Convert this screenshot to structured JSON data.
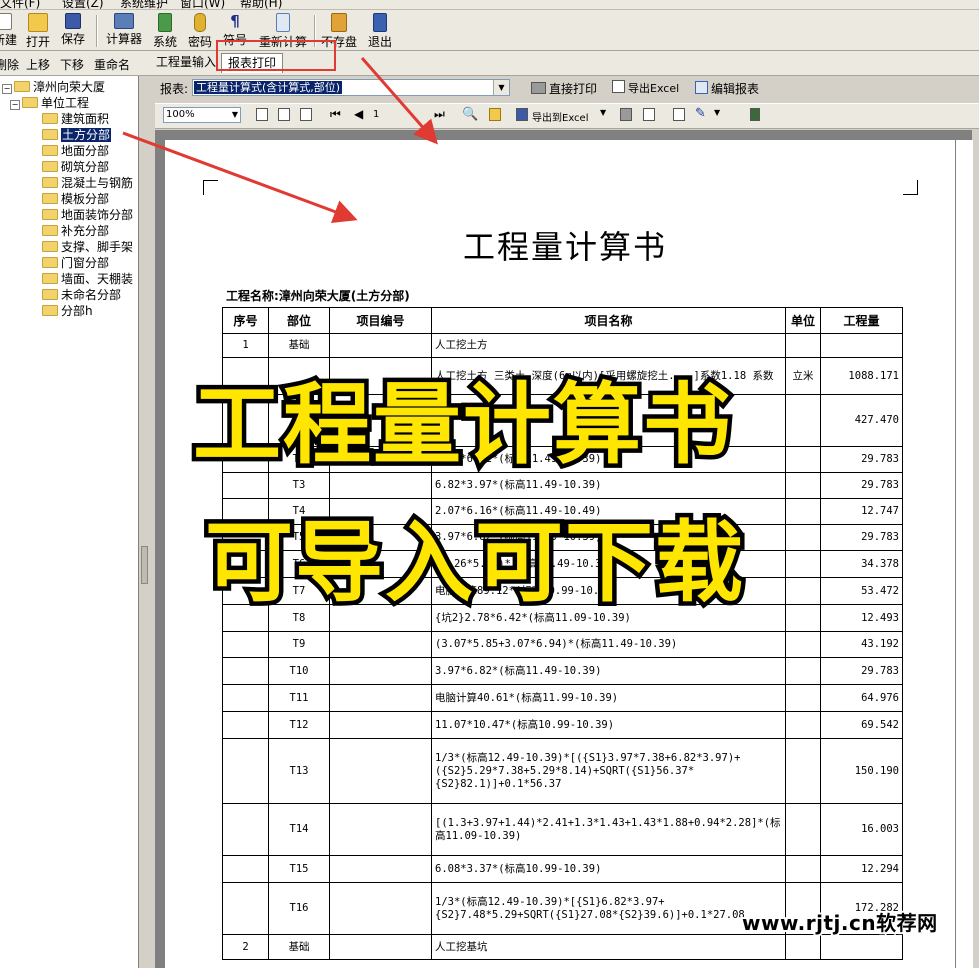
{
  "menu": {
    "items": [
      "文件(F)",
      "设置(Z)",
      "系统维护",
      "窗口(W)",
      "帮助(H)"
    ]
  },
  "toolbar": {
    "buttons": [
      {
        "label": "新建",
        "icon": "new-file-icon"
      },
      {
        "label": "打开",
        "icon": "open-folder-icon"
      },
      {
        "label": "保存",
        "icon": "save-disk-icon"
      },
      {
        "label": "计算器",
        "icon": "calculator-icon"
      },
      {
        "label": "系统",
        "icon": "system-icon"
      },
      {
        "label": "密码",
        "icon": "key-icon"
      },
      {
        "label": "符号",
        "icon": "pilcrow-icon"
      },
      {
        "label": "重新计算",
        "icon": "recalculate-icon"
      },
      {
        "label": "不存盘",
        "icon": "no-save-icon"
      },
      {
        "label": "退出",
        "icon": "exit-door-icon"
      }
    ]
  },
  "tree_actions": [
    "删除",
    "上移",
    "下移",
    "重命名"
  ],
  "tabs": [
    {
      "label": "工程量输入",
      "active": false
    },
    {
      "label": "报表打印",
      "active": true
    }
  ],
  "tree": {
    "root": "漳州向荣大厦",
    "unit": "单位工程",
    "items": [
      "建筑面积",
      "土方分部",
      "地面分部",
      "砌筑分部",
      "混凝土与钢筋",
      "模板分部",
      "地面装饰分部",
      "补充分部",
      "支撑、脚手架",
      "门窗分部",
      "墙面、天棚装",
      "未命名分部",
      "分部h"
    ],
    "selected": "土方分部"
  },
  "report_bar": {
    "label": "报表:",
    "selected": "工程量计算式(含计算式,部位)",
    "direct_print": "直接打印",
    "export_excel": "导出Excel",
    "edit_report": "编辑报表"
  },
  "preview_bar": {
    "zoom": "100%",
    "page": "1",
    "export_to_excel": "导出到Excel"
  },
  "document": {
    "title": "工程量计算书",
    "project_line": "工程名称:漳州向荣大厦(土方分部)",
    "headers": [
      "序号",
      "部位",
      "项目编号",
      "项目名称",
      "单位",
      "工程量"
    ],
    "rows": [
      {
        "no": "1",
        "part": "基础",
        "code": "",
        "name": "人工挖土方",
        "unit": "",
        "qty": ""
      },
      {
        "no": "",
        "part": "",
        "code": "",
        "name": "人工挖土方 三类土 深度(6m以内)[采用螺旋挖土....]系数1.18 系数",
        "unit": "立米",
        "qty": "1088.171"
      },
      {
        "no": "",
        "part": "T1",
        "code": "",
        "name": "",
        "unit": "",
        "qty": "427.470"
      },
      {
        "no": "",
        "part": "T2",
        "code": "",
        "name": "3.97*6.82*(标高11.49-10.39)",
        "unit": "",
        "qty": "29.783"
      },
      {
        "no": "",
        "part": "T3",
        "code": "",
        "name": "6.82*3.97*(标高11.49-10.39)",
        "unit": "",
        "qty": "29.783"
      },
      {
        "no": "",
        "part": "T4",
        "code": "",
        "name": "2.07*6.16*(标高11.49-10.49)",
        "unit": "",
        "qty": "12.747"
      },
      {
        "no": "",
        "part": "T5",
        "code": "",
        "name": "3.97*6.82*(标高11.49-10.39)",
        "unit": "",
        "qty": "29.783"
      },
      {
        "no": "",
        "part": "T6",
        "code": "",
        "name": "(5.26*5.94)*(标高11.49-10.39)",
        "unit": "",
        "qty": "34.378"
      },
      {
        "no": "",
        "part": "T7",
        "code": "",
        "name": "电脑计算89.12*(标高10.99-10.39)",
        "unit": "",
        "qty": "53.472"
      },
      {
        "no": "",
        "part": "T8",
        "code": "",
        "name": "{坑2}2.78*6.42*(标高11.09-10.39)",
        "unit": "",
        "qty": "12.493"
      },
      {
        "no": "",
        "part": "T9",
        "code": "",
        "name": "(3.07*5.85+3.07*6.94)*(标高11.49-10.39)",
        "unit": "",
        "qty": "43.192"
      },
      {
        "no": "",
        "part": "T10",
        "code": "",
        "name": "3.97*6.82*(标高11.49-10.39)",
        "unit": "",
        "qty": "29.783"
      },
      {
        "no": "",
        "part": "T11",
        "code": "",
        "name": "电脑计算40.61*(标高11.99-10.39)",
        "unit": "",
        "qty": "64.976"
      },
      {
        "no": "",
        "part": "T12",
        "code": "",
        "name": "11.07*10.47*(标高10.99-10.39)",
        "unit": "",
        "qty": "69.542"
      },
      {
        "no": "",
        "part": "T13",
        "code": "",
        "name": "1/3*(标高12.49-10.39)*[({S1}3.97*7.38+6.82*3.97)+({S2}5.29*7.38+5.29*8.14)+SQRT({S1}56.37*{S2}82.1)]+0.1*56.37",
        "unit": "",
        "qty": "150.190"
      },
      {
        "no": "",
        "part": "T14",
        "code": "",
        "name": "[(1.3+3.97+1.44)*2.41+1.3*1.43+1.43*1.88+0.94*2.28]*(标高11.09-10.39)",
        "unit": "",
        "qty": "16.003"
      },
      {
        "no": "",
        "part": "T15",
        "code": "",
        "name": "6.08*3.37*(标高10.99-10.39)",
        "unit": "",
        "qty": "12.294"
      },
      {
        "no": "",
        "part": "T16",
        "code": "",
        "name": "1/3*(标高12.49-10.39)*[{S1}6.82*3.97+{S2}7.48*5.29+SQRT({S1}27.08*{S2}39.6)]+0.1*27.08",
        "unit": "",
        "qty": "172.282"
      },
      {
        "no": "2",
        "part": "基础",
        "code": "",
        "name": "人工挖基坑",
        "unit": "",
        "qty": ""
      }
    ]
  },
  "overlay": {
    "line1": "工程量计算书",
    "line2": "可导入可下载",
    "watermark": "www.rjtj.cn软荐网",
    "accent": "#ffe600",
    "arrow_color": "#e03a32"
  }
}
